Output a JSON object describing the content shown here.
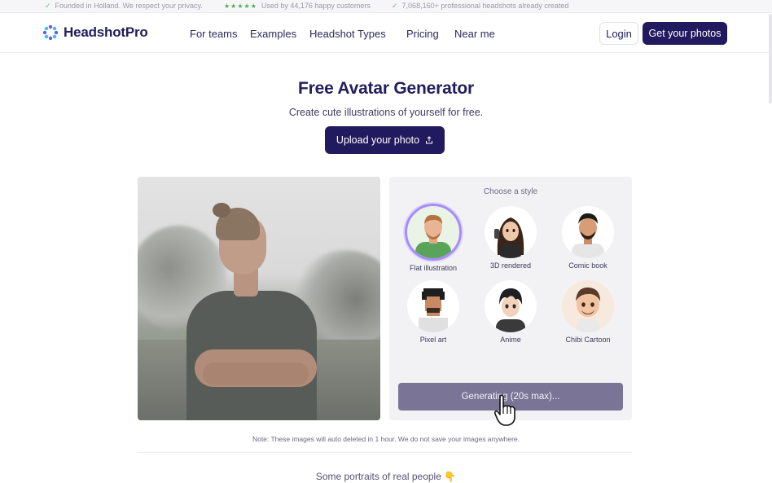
{
  "topbar": {
    "items": [
      {
        "text": "Founded in Holland. We respect your privacy."
      },
      {
        "stars": "★★★★★",
        "text": "Used by 44,176 happy customers"
      },
      {
        "text": "7,068,160+ professional headshots already created"
      }
    ]
  },
  "nav": {
    "brand": "HeadshotPro",
    "links": [
      "For teams",
      "Examples",
      "Headshot Types",
      "Pricing",
      "Near me"
    ],
    "login": "Login",
    "cta": "Get your photos"
  },
  "hero": {
    "title": "Free Avatar Generator",
    "subtitle": "Create cute illustrations of yourself for free.",
    "upload_label": "Upload your photo"
  },
  "style_panel": {
    "title": "Choose a style",
    "styles": [
      {
        "label": "Flat illustration",
        "selected": true
      },
      {
        "label": "3D rendered",
        "selected": false
      },
      {
        "label": "Comic book",
        "selected": false
      },
      {
        "label": "Pixel art",
        "selected": false
      },
      {
        "label": "Anime",
        "selected": false
      },
      {
        "label": "Chibi Cartoon",
        "selected": false
      }
    ],
    "generate_label": "Generating (20s max)..."
  },
  "note": "Note: These images will auto deleted in 1 hour. We do not save your images anywhere.",
  "portraits_heading": "Some portraits of real people 👇",
  "colors": {
    "brand": "#221a5e",
    "selected_ring": "#a78bfa",
    "generating_button": "#7a7596"
  }
}
